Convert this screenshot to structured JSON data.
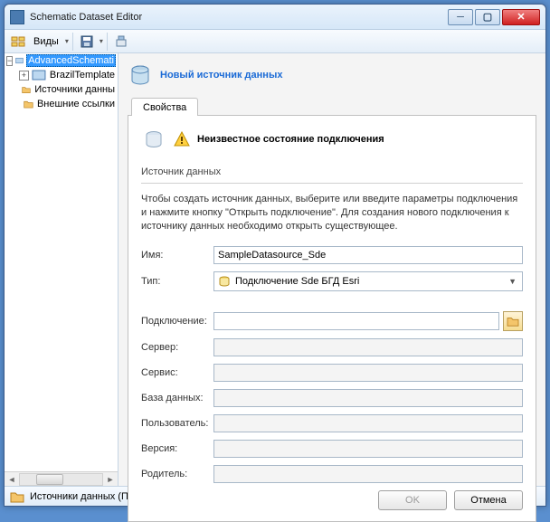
{
  "window": {
    "title": "Schematic Dataset Editor"
  },
  "toolbar": {
    "views_label": "Виды"
  },
  "tree": {
    "items": [
      {
        "label": "AdvancedSchemati",
        "selected": true,
        "expandable": true,
        "expanded": true,
        "indent": 0
      },
      {
        "label": "BrazilTemplate",
        "expandable": true,
        "expanded": false,
        "indent": 1
      },
      {
        "label": "Источники данны",
        "indent": 1,
        "folder": true
      },
      {
        "label": "Внешние ссылки",
        "indent": 1,
        "folder": true
      }
    ]
  },
  "header": {
    "link": "Новый источник данных"
  },
  "tabs": {
    "active": "Свойства"
  },
  "panel": {
    "warning": "Неизвестное состояние подключения",
    "section_title": "Источник данных",
    "description": "Чтобы создать источник данных, выберите или введите параметры подключения и нажмите кнопку \"Открыть подключение\". Для создания нового подключения к источнику данных необходимо открыть существующее.",
    "fields": {
      "name": {
        "label": "Имя:",
        "value": "SampleDatasource_Sde"
      },
      "type": {
        "label": "Тип:",
        "value": "Подключение Sde БГД Esri"
      },
      "connection": {
        "label": "Подключение:",
        "value": ""
      },
      "server": {
        "label": "Сервер:",
        "value": ""
      },
      "service": {
        "label": "Сервис:",
        "value": ""
      },
      "database": {
        "label": "База данных:",
        "value": ""
      },
      "user": {
        "label": "Пользователь:",
        "value": ""
      },
      "version": {
        "label": "Версия:",
        "value": ""
      },
      "parent": {
        "label": "Родитель:",
        "value": ""
      }
    },
    "buttons": {
      "ok": "OK",
      "cancel": "Отмена"
    }
  },
  "statusbar": {
    "text": "Источники данных (Папка)"
  }
}
